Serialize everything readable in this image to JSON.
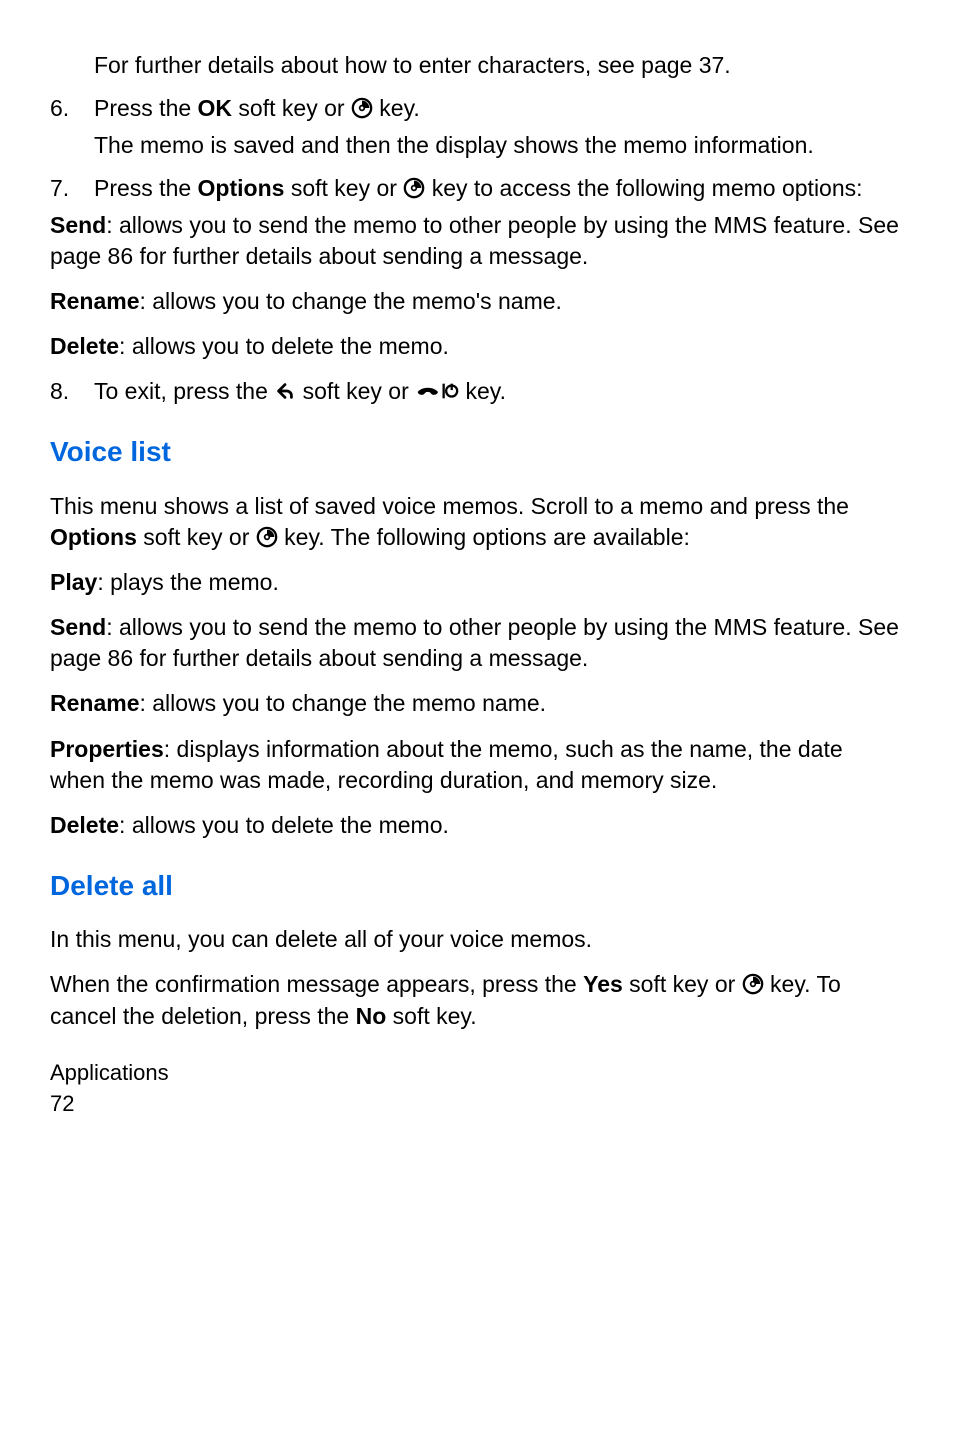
{
  "step5_sub": "For further details about how to enter characters, see page 37.",
  "step6": {
    "num": "6.",
    "a": "Press the ",
    "b": "OK",
    "c": " soft key or ",
    "d": " key."
  },
  "step6_sub": "The memo is saved and then the display shows the memo information.",
  "step7": {
    "num": "7.",
    "a": "Press the ",
    "b": "Options",
    "c": " soft key or ",
    "d": " key to access the following memo options:"
  },
  "sec1": {
    "send": {
      "label": "Send",
      "text": ": allows you to send the memo to other people by using the MMS feature. See page 86 for further details about sending a message."
    },
    "rename": {
      "label": "Rename",
      "text": ": allows you to change the memo's name."
    },
    "delete": {
      "label": "Delete",
      "text": ": allows you to delete the memo."
    }
  },
  "step8": {
    "num": "8.",
    "a": "To exit, press the ",
    "b": " soft key or ",
    "c": " key."
  },
  "voice_heading": "Voice list",
  "voice_intro": {
    "a": "This menu shows a list of saved voice memos. Scroll to a memo and press the ",
    "b": "Options",
    "c": " soft key or ",
    "d": " key. The following options are available:"
  },
  "sec2": {
    "play": {
      "label": "Play",
      "text": ": plays the memo."
    },
    "send": {
      "label": "Send",
      "text": ": allows you to send the memo to other people by using the MMS feature. See page 86 for further details about sending a message."
    },
    "rename": {
      "label": "Rename",
      "text": ": allows you to change the memo name."
    },
    "properties": {
      "label": "Properties",
      "text": ": displays information about the memo, such as the name, the date when the memo was made, recording duration, and memory size."
    },
    "delete": {
      "label": "Delete",
      "text": ": allows you to delete the memo."
    }
  },
  "delete_all_heading": "Delete all",
  "delete_all_intro": "In this menu, you can delete all of your voice memos.",
  "delete_all_confirm": {
    "a": "When the confirmation message appears, press the ",
    "b": "Yes",
    "c": " soft key or ",
    "d": " key. To cancel the deletion, press the ",
    "e": "No",
    "f": " soft key."
  },
  "footer_section": "Applications",
  "footer_page": "72"
}
